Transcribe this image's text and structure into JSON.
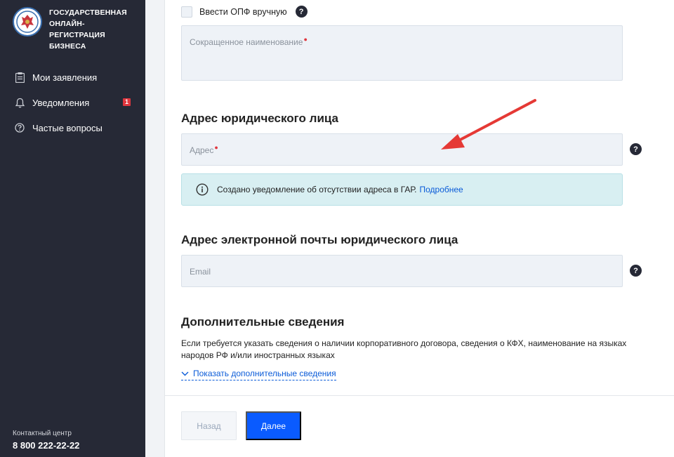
{
  "sidebar": {
    "logo_text": "Государственная\nонлайн-регистрация\nбизнеса",
    "items": [
      {
        "label": "Мои заявления",
        "icon": "document-icon"
      },
      {
        "label": "Уведомления",
        "icon": "bell-icon",
        "badge": "1"
      },
      {
        "label": "Частые вопросы",
        "icon": "question-circle-icon"
      }
    ],
    "contact_label": "Контактный центр",
    "contact_phone": "8 800 222-22-22"
  },
  "form": {
    "opf_checkbox_label": "Ввести ОПФ вручную",
    "short_name_placeholder": "Сокращенное наименование",
    "address_section_title": "Адрес юридического лица",
    "address_placeholder": "Адрес",
    "info_text": "Создано уведомление об отсутствии адреса в ГАР.",
    "info_link": "Подробнее",
    "email_section_title": "Адрес электронной почты юридического лица",
    "email_placeholder": "Email",
    "extra_section_title": "Дополнительные сведения",
    "extra_description": "Если требуется указать сведения о наличии корпоративного договора, сведения о КФХ, наименование на языках народов РФ и/или иностранных языках",
    "extra_toggle": "Показать дополнительные сведения",
    "help_mark": "?"
  },
  "buttons": {
    "back": "Назад",
    "next": "Далее"
  },
  "colors": {
    "sidebar_bg": "#262936",
    "primary": "#0a5bff",
    "required": "#e0363e",
    "info_bg": "#d8eff2",
    "annotation_arrow": "#e53935"
  }
}
